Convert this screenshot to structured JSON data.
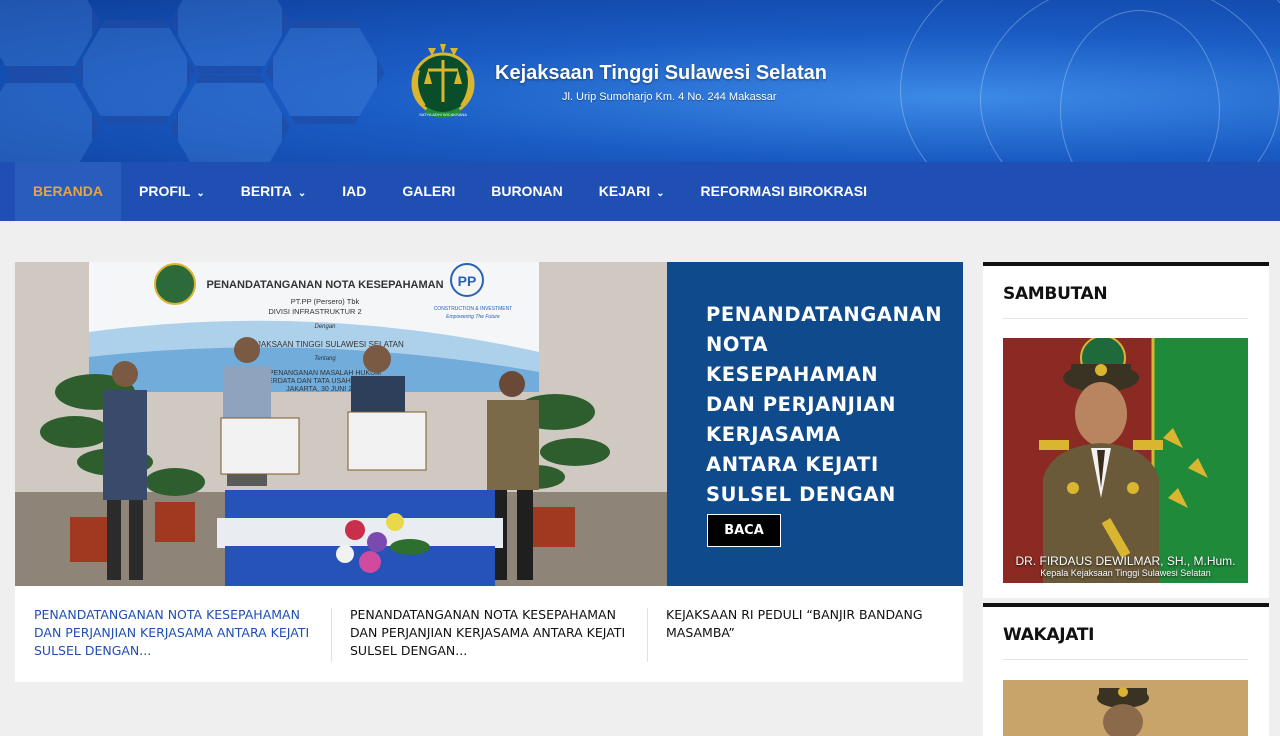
{
  "header": {
    "title": "Kejaksaan Tinggi Sulawesi Selatan",
    "address": "Jl. Urip Sumoharjo Km. 4 No. 244 Makassar",
    "logo_icon": "kejaksaan-emblem-icon",
    "logo_text": "SATYA ADHI WICAKSANA"
  },
  "nav": {
    "items": [
      {
        "label": "BERANDA",
        "active": true
      },
      {
        "label": "PROFIL",
        "dropdown": true
      },
      {
        "label": "BERITA",
        "dropdown": true
      },
      {
        "label": "IAD"
      },
      {
        "label": "GALERI"
      },
      {
        "label": "BURONAN"
      },
      {
        "label": "KEJARI",
        "dropdown": true
      },
      {
        "label": "REFORMASI BIROKRASI"
      }
    ]
  },
  "slider": {
    "title": "PENANDATANGANAN NOTA KESEPAHAMAN DAN PERJANJIAN KERJASAMA ANTARA KEJATI SULSEL DENGAN PT.",
    "button": "BACA",
    "photo_banner": {
      "heading": "PENANDATANGANAN NOTA KESEPAHAMAN",
      "line1": "PT.PP (Persero) Tbk",
      "line2": "DIVISI INFRASTRUKTUR 2",
      "line3": "Dengan",
      "line4": "KEJAKSAAN TINGGI SULAWESI SELATAN",
      "line5": "Tentang",
      "line6": "PENANGANAN MASALAH HUKUM",
      "line7": "PERDATA DAN TATA USAHA NEGARA",
      "line8": "JAKARTA, 30 JUNI 2020",
      "pp_logo": "PP",
      "pp_tag1": "CONSTRUCTION & INVESTMENT",
      "pp_tag2": "Empowering The Future"
    }
  },
  "posts": [
    {
      "title": "PENANDATANGANAN NOTA KESEPAHAMAN DAN PERJANJIAN KERJASAMA ANTARA KEJATI SULSEL DENGAN...",
      "active": true
    },
    {
      "title": "PENANDATANGANAN NOTA KESEPAHAMAN DAN PERJANJIAN KERJASAMA ANTARA KEJATI SULSEL DENGAN..."
    },
    {
      "title": "KEJAKSAAN RI PEDULI “BANJIR BANDANG MASAMBA”"
    }
  ],
  "sidebar": {
    "sambutan": {
      "title": "SAMBUTAN",
      "name": "DR. FIRDAUS DEWILMAR, SH., M.Hum.",
      "role": "Kepala Kejaksaan Tinggi Sulawesi Selatan"
    },
    "wakajati": {
      "title": "WAKAJATI"
    }
  },
  "colors": {
    "nav_bg": "#1f4fb3",
    "nav_active_text": "#e8a53a",
    "slide_panel": "#0f4a8c",
    "post_active": "#1f4fb3"
  }
}
